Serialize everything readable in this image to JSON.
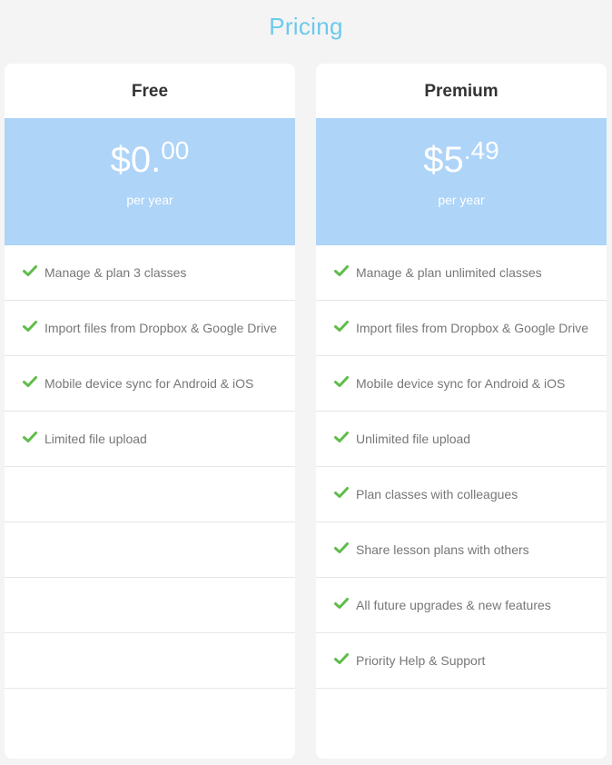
{
  "page": {
    "title": "Pricing"
  },
  "colors": {
    "title": "#6cc9ec",
    "price_bg": "#aed4f8",
    "check": "#5fbd4a",
    "background": "#f4f4f4"
  },
  "plans": [
    {
      "name": "Free",
      "price": {
        "currency": "$",
        "dollars": "0.",
        "cents": "00",
        "period": "per year"
      },
      "features": [
        "Manage & plan 3 classes",
        "Import files from Dropbox & Google Drive",
        "Mobile device sync for Android & iOS",
        "Limited file upload",
        "",
        "",
        "",
        ""
      ]
    },
    {
      "name": "Premium",
      "price": {
        "currency": "$",
        "dollars": "5",
        "cents": ".49",
        "period": "per year"
      },
      "features": [
        "Manage & plan unlimited classes",
        "Import files from Dropbox & Google Drive",
        "Mobile device sync for Android & iOS",
        "Unlimited file upload",
        "Plan classes with colleagues",
        "Share lesson plans with others",
        "All future upgrades & new features",
        "Priority Help & Support"
      ]
    }
  ]
}
